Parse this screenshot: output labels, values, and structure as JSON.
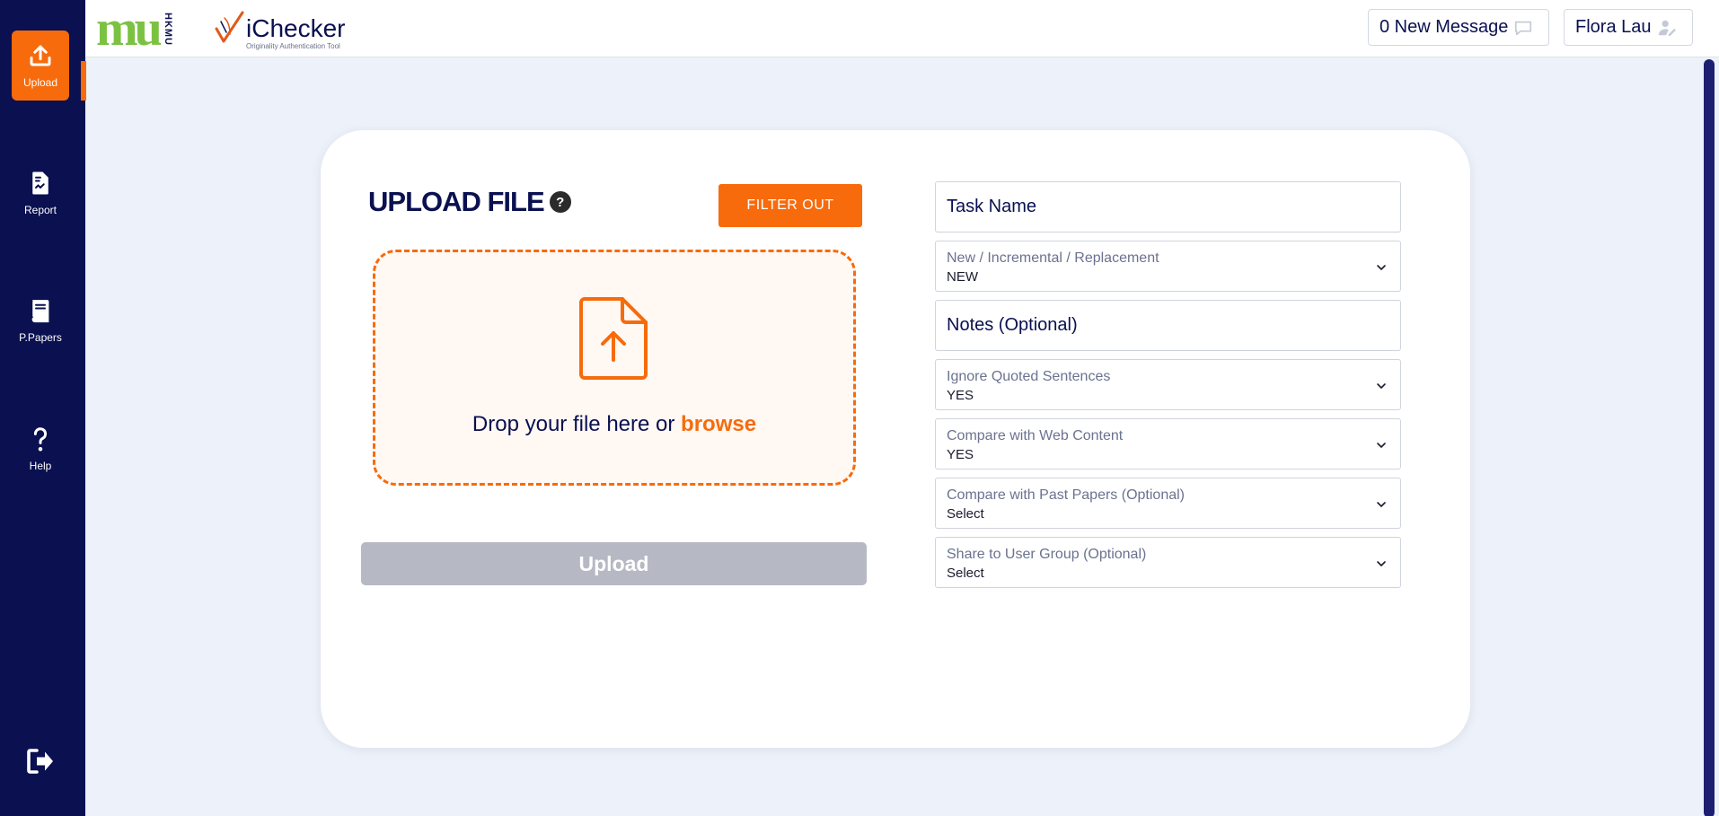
{
  "sidebar": {
    "items": [
      {
        "label": "Upload",
        "icon": "upload-icon"
      },
      {
        "label": "Report",
        "icon": "report-icon"
      },
      {
        "label": "P.Papers",
        "icon": "book-icon"
      },
      {
        "label": "Help",
        "icon": "help-icon"
      }
    ],
    "logout_icon": "logout-icon"
  },
  "header": {
    "logo_mu": "mu",
    "logo_hkmu": "HKMU",
    "logo_brand": "iChecker",
    "logo_tagline": "Originality Authentication Tool",
    "messages_label": "0 New Message",
    "user_name": "Flora Lau"
  },
  "upload": {
    "title": "UPLOAD FILE",
    "help_glyph": "?",
    "filter_label": "FILTER OUT",
    "drop_text": "Drop your file here or ",
    "browse_label": "browse",
    "upload_label": "Upload"
  },
  "form": {
    "task_name_placeholder": "Task Name",
    "upload_type": {
      "label": "New / Incremental / Replacement",
      "value": "NEW"
    },
    "notes_placeholder": "Notes (Optional)",
    "ignore_quoted": {
      "label": "Ignore Quoted Sentences",
      "value": "YES"
    },
    "compare_web": {
      "label": "Compare with Web Content",
      "value": "YES"
    },
    "compare_past": {
      "label": "Compare with Past Papers (Optional)",
      "value": "Select"
    },
    "share_group": {
      "label": "Share to User Group (Optional)",
      "value": "Select"
    }
  },
  "colors": {
    "accent": "#f76b0c",
    "navy": "#0a1050",
    "background": "#edf1f9",
    "disabled": "#b6b9c3"
  }
}
